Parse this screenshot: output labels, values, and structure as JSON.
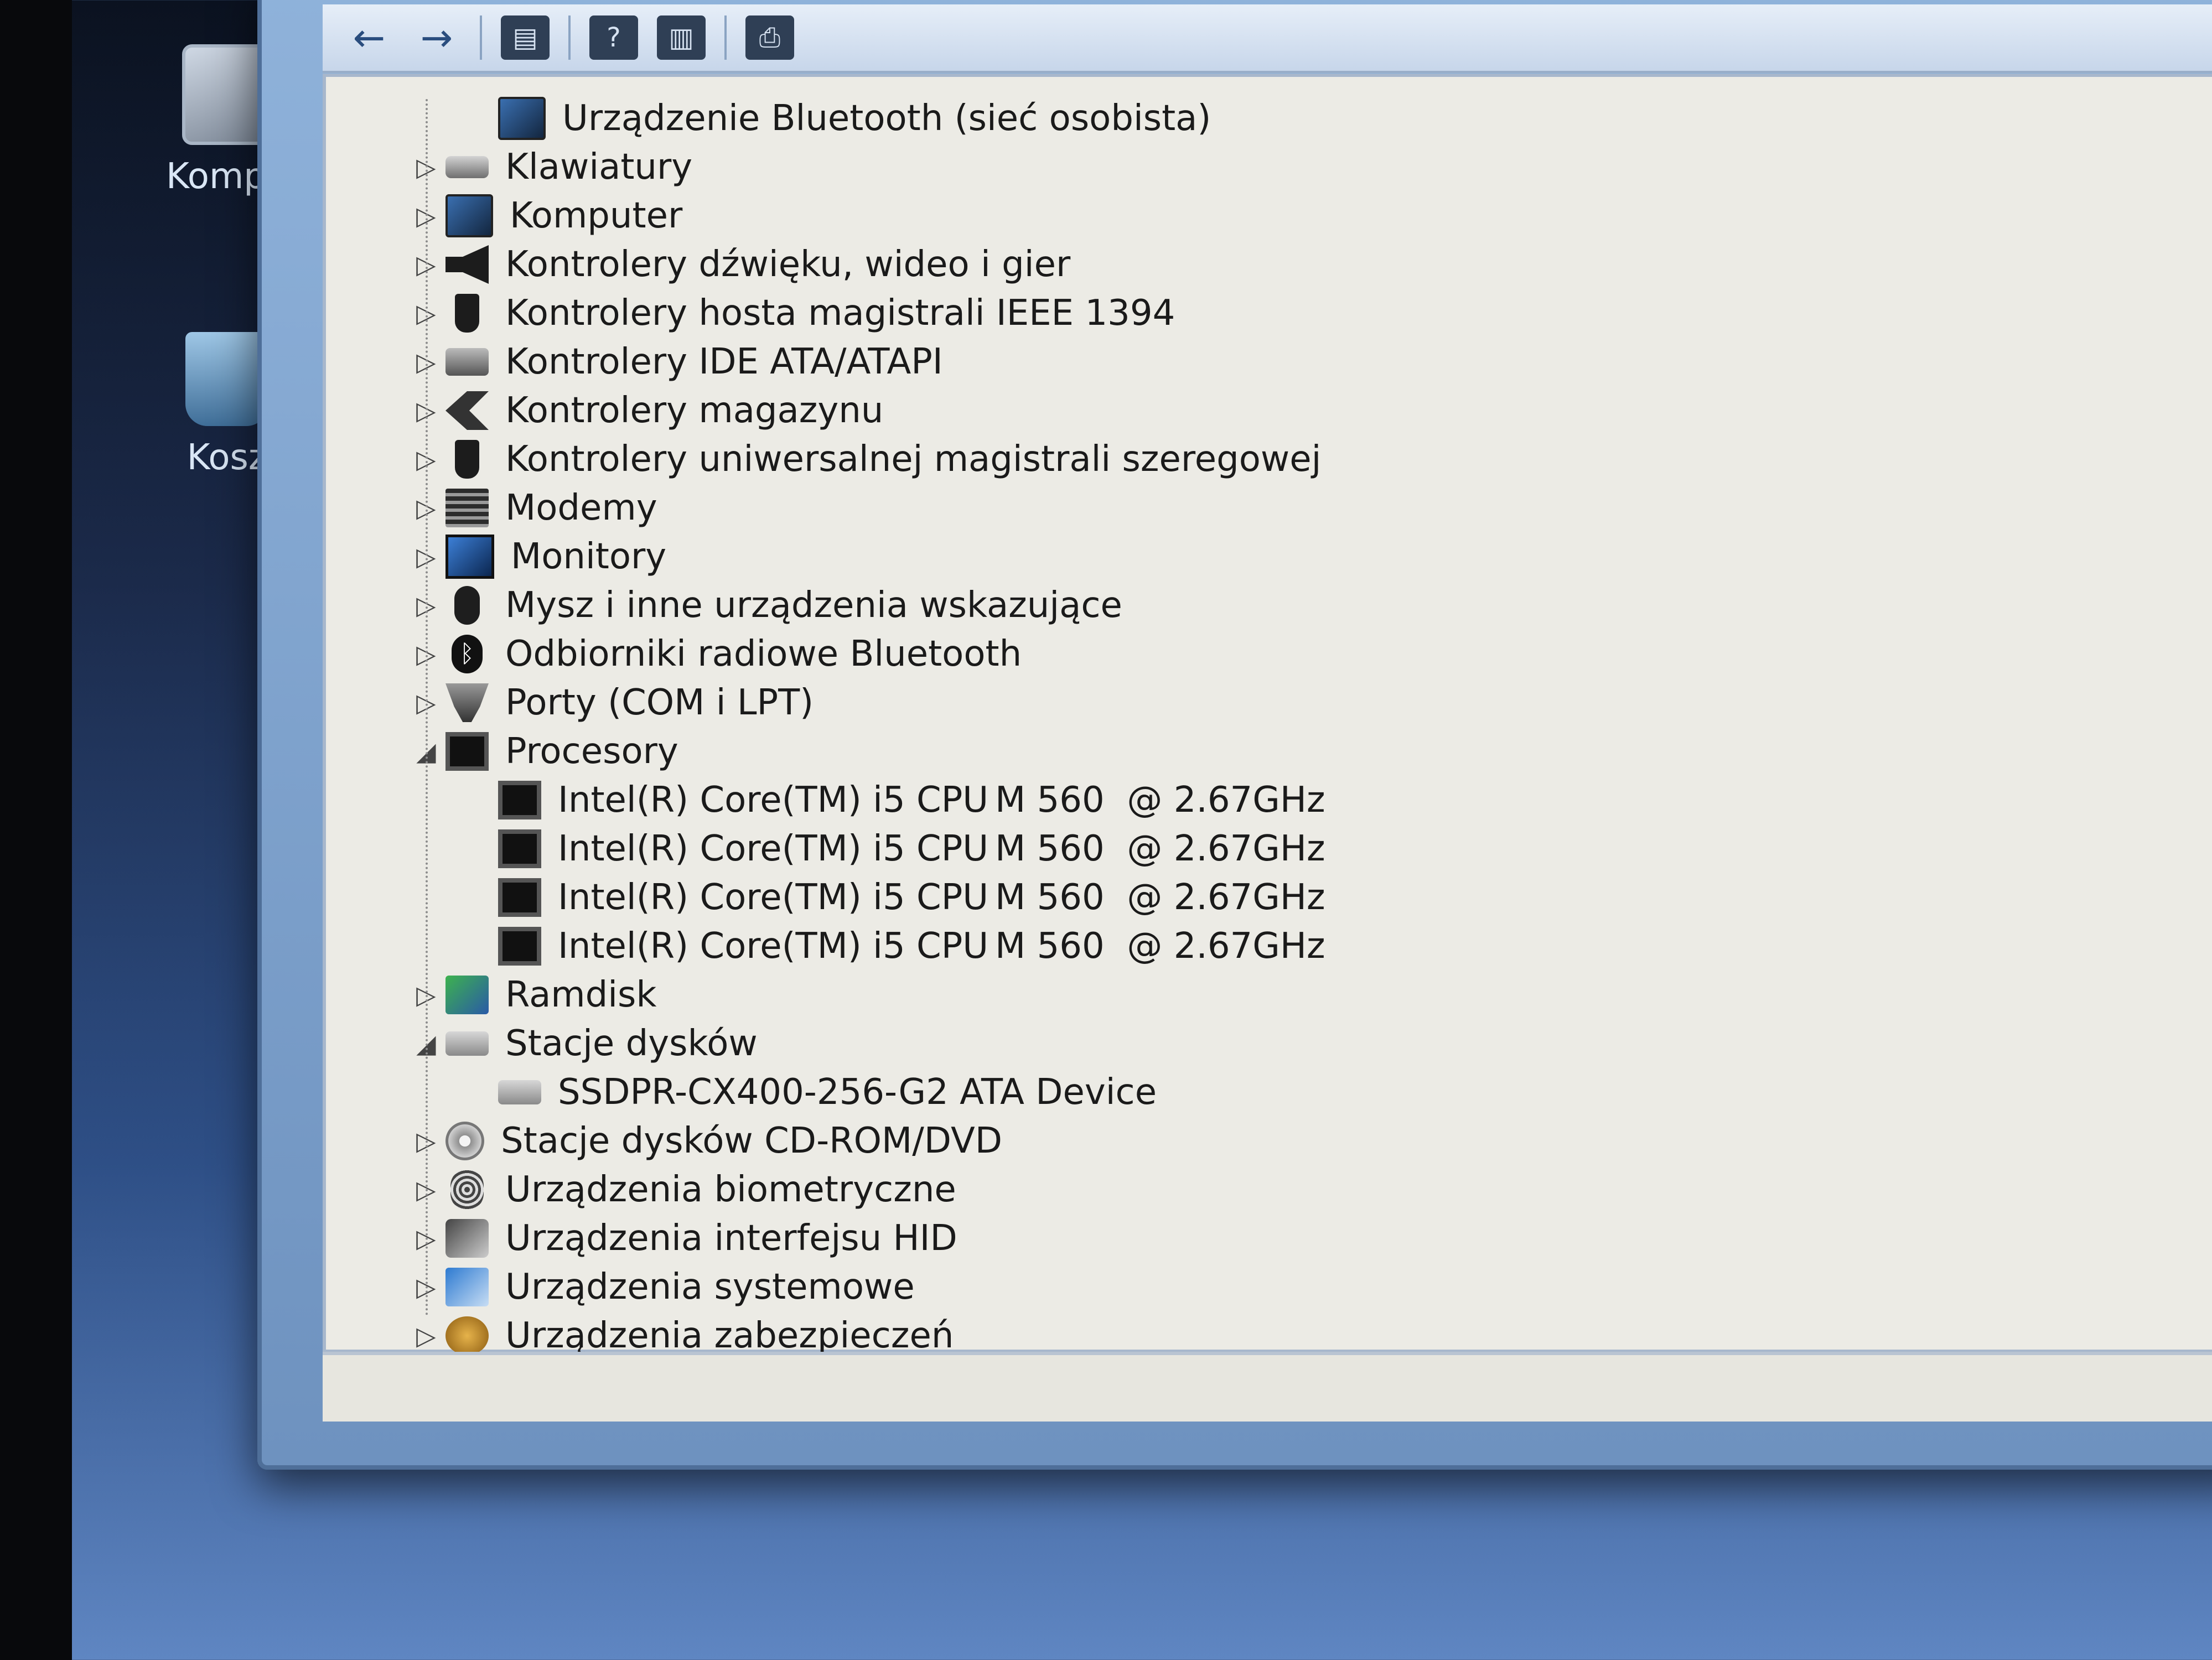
{
  "desktop": {
    "icons": [
      {
        "id": "computer",
        "label": "Kompu"
      },
      {
        "id": "recycle-bin",
        "label": "Kosz"
      }
    ]
  },
  "toolbar": {
    "buttons": [
      {
        "name": "back",
        "glyph": "←"
      },
      {
        "name": "forward",
        "glyph": "→"
      },
      {
        "name": "properties",
        "glyph": "▤"
      },
      {
        "name": "help",
        "glyph": "?"
      },
      {
        "name": "view",
        "glyph": "▥"
      },
      {
        "name": "scan-hardware",
        "glyph": "⎙"
      }
    ]
  },
  "device_tree": {
    "items": [
      {
        "label": "Urządzenie Bluetooth (sieć osobista)",
        "level": 1,
        "expander": "",
        "icon": "pc-icon"
      },
      {
        "label": "Klawiatury",
        "level": 0,
        "expander": "▷",
        "icon": "keyboard-icon"
      },
      {
        "label": "Komputer",
        "level": 0,
        "expander": "▷",
        "icon": "computer-icon"
      },
      {
        "label": "Kontrolery dźwięku, wideo i gier",
        "level": 0,
        "expander": "▷",
        "icon": "speaker-icon"
      },
      {
        "label": "Kontrolery hosta magistrali IEEE 1394",
        "level": 0,
        "expander": "▷",
        "icon": "plug-icon"
      },
      {
        "label": "Kontrolery IDE ATA/ATAPI",
        "level": 0,
        "expander": "▷",
        "icon": "ide-controller-icon"
      },
      {
        "label": "Kontrolery magazynu",
        "level": 0,
        "expander": "▷",
        "icon": "storage-controller-icon"
      },
      {
        "label": "Kontrolery uniwersalnej magistrali szeregowej",
        "level": 0,
        "expander": "▷",
        "icon": "usb-icon"
      },
      {
        "label": "Modemy",
        "level": 0,
        "expander": "▷",
        "icon": "modem-icon"
      },
      {
        "label": "Monitory",
        "level": 0,
        "expander": "▷",
        "icon": "monitor-icon"
      },
      {
        "label": "Mysz i inne urządzenia wskazujące",
        "level": 0,
        "expander": "▷",
        "icon": "mouse-icon"
      },
      {
        "label": "Odbiorniki radiowe Bluetooth",
        "level": 0,
        "expander": "▷",
        "icon": "bluetooth-icon"
      },
      {
        "label": "Porty (COM i LPT)",
        "level": 0,
        "expander": "▷",
        "icon": "port-icon"
      },
      {
        "label": "Procesory",
        "level": 0,
        "expander": "◢",
        "icon": "processor-icon"
      },
      {
        "label": "Intel(R) Core(TM) i5 CPU",
        "suffix": "M 560  @ 2.67GHz",
        "level": 1,
        "expander": "",
        "icon": "processor-icon"
      },
      {
        "label": "Intel(R) Core(TM) i5 CPU",
        "suffix": "M 560  @ 2.67GHz",
        "level": 1,
        "expander": "",
        "icon": "processor-icon"
      },
      {
        "label": "Intel(R) Core(TM) i5 CPU",
        "suffix": "M 560  @ 2.67GHz",
        "level": 1,
        "expander": "",
        "icon": "processor-icon"
      },
      {
        "label": "Intel(R) Core(TM) i5 CPU",
        "suffix": "M 560  @ 2.67GHz",
        "level": 1,
        "expander": "",
        "icon": "processor-icon"
      },
      {
        "label": "Ramdisk",
        "level": 0,
        "expander": "▷",
        "icon": "network-icon"
      },
      {
        "label": "Stacje dysków",
        "level": 0,
        "expander": "◢",
        "icon": "disk-drive-icon"
      },
      {
        "label": "SSDPR-CX400-256-G2 ATA Device",
        "level": 1,
        "expander": "",
        "icon": "disk-drive-icon"
      },
      {
        "label": "Stacje dysków CD-ROM/DVD",
        "level": 0,
        "expander": "▷",
        "icon": "cd-drive-icon"
      },
      {
        "label": "Urządzenia biometryczne",
        "level": 0,
        "expander": "▷",
        "icon": "fingerprint-icon"
      },
      {
        "label": "Urządzenia interfejsu HID",
        "level": 0,
        "expander": "▷",
        "icon": "hid-icon"
      },
      {
        "label": "Urządzenia systemowe",
        "level": 0,
        "expander": "▷",
        "icon": "system-icon"
      },
      {
        "label": "Urządzenia zabezpieczeń",
        "level": 0,
        "expander": "▷",
        "icon": "security-icon"
      }
    ]
  }
}
